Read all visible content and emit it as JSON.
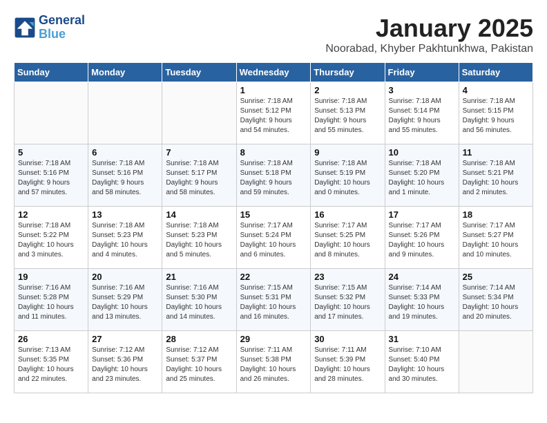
{
  "logo": {
    "line1": "General",
    "line2": "Blue"
  },
  "title": "January 2025",
  "subtitle": "Noorabad, Khyber Pakhtunkhwa, Pakistan",
  "days_of_week": [
    "Sunday",
    "Monday",
    "Tuesday",
    "Wednesday",
    "Thursday",
    "Friday",
    "Saturday"
  ],
  "weeks": [
    [
      {
        "day": "",
        "info": ""
      },
      {
        "day": "",
        "info": ""
      },
      {
        "day": "",
        "info": ""
      },
      {
        "day": "1",
        "info": "Sunrise: 7:18 AM\nSunset: 5:12 PM\nDaylight: 9 hours\nand 54 minutes."
      },
      {
        "day": "2",
        "info": "Sunrise: 7:18 AM\nSunset: 5:13 PM\nDaylight: 9 hours\nand 55 minutes."
      },
      {
        "day": "3",
        "info": "Sunrise: 7:18 AM\nSunset: 5:14 PM\nDaylight: 9 hours\nand 55 minutes."
      },
      {
        "day": "4",
        "info": "Sunrise: 7:18 AM\nSunset: 5:15 PM\nDaylight: 9 hours\nand 56 minutes."
      }
    ],
    [
      {
        "day": "5",
        "info": "Sunrise: 7:18 AM\nSunset: 5:16 PM\nDaylight: 9 hours\nand 57 minutes."
      },
      {
        "day": "6",
        "info": "Sunrise: 7:18 AM\nSunset: 5:16 PM\nDaylight: 9 hours\nand 58 minutes."
      },
      {
        "day": "7",
        "info": "Sunrise: 7:18 AM\nSunset: 5:17 PM\nDaylight: 9 hours\nand 58 minutes."
      },
      {
        "day": "8",
        "info": "Sunrise: 7:18 AM\nSunset: 5:18 PM\nDaylight: 9 hours\nand 59 minutes."
      },
      {
        "day": "9",
        "info": "Sunrise: 7:18 AM\nSunset: 5:19 PM\nDaylight: 10 hours\nand 0 minutes."
      },
      {
        "day": "10",
        "info": "Sunrise: 7:18 AM\nSunset: 5:20 PM\nDaylight: 10 hours\nand 1 minute."
      },
      {
        "day": "11",
        "info": "Sunrise: 7:18 AM\nSunset: 5:21 PM\nDaylight: 10 hours\nand 2 minutes."
      }
    ],
    [
      {
        "day": "12",
        "info": "Sunrise: 7:18 AM\nSunset: 5:22 PM\nDaylight: 10 hours\nand 3 minutes."
      },
      {
        "day": "13",
        "info": "Sunrise: 7:18 AM\nSunset: 5:23 PM\nDaylight: 10 hours\nand 4 minutes."
      },
      {
        "day": "14",
        "info": "Sunrise: 7:18 AM\nSunset: 5:23 PM\nDaylight: 10 hours\nand 5 minutes."
      },
      {
        "day": "15",
        "info": "Sunrise: 7:17 AM\nSunset: 5:24 PM\nDaylight: 10 hours\nand 6 minutes."
      },
      {
        "day": "16",
        "info": "Sunrise: 7:17 AM\nSunset: 5:25 PM\nDaylight: 10 hours\nand 8 minutes."
      },
      {
        "day": "17",
        "info": "Sunrise: 7:17 AM\nSunset: 5:26 PM\nDaylight: 10 hours\nand 9 minutes."
      },
      {
        "day": "18",
        "info": "Sunrise: 7:17 AM\nSunset: 5:27 PM\nDaylight: 10 hours\nand 10 minutes."
      }
    ],
    [
      {
        "day": "19",
        "info": "Sunrise: 7:16 AM\nSunset: 5:28 PM\nDaylight: 10 hours\nand 11 minutes."
      },
      {
        "day": "20",
        "info": "Sunrise: 7:16 AM\nSunset: 5:29 PM\nDaylight: 10 hours\nand 13 minutes."
      },
      {
        "day": "21",
        "info": "Sunrise: 7:16 AM\nSunset: 5:30 PM\nDaylight: 10 hours\nand 14 minutes."
      },
      {
        "day": "22",
        "info": "Sunrise: 7:15 AM\nSunset: 5:31 PM\nDaylight: 10 hours\nand 16 minutes."
      },
      {
        "day": "23",
        "info": "Sunrise: 7:15 AM\nSunset: 5:32 PM\nDaylight: 10 hours\nand 17 minutes."
      },
      {
        "day": "24",
        "info": "Sunrise: 7:14 AM\nSunset: 5:33 PM\nDaylight: 10 hours\nand 19 minutes."
      },
      {
        "day": "25",
        "info": "Sunrise: 7:14 AM\nSunset: 5:34 PM\nDaylight: 10 hours\nand 20 minutes."
      }
    ],
    [
      {
        "day": "26",
        "info": "Sunrise: 7:13 AM\nSunset: 5:35 PM\nDaylight: 10 hours\nand 22 minutes."
      },
      {
        "day": "27",
        "info": "Sunrise: 7:12 AM\nSunset: 5:36 PM\nDaylight: 10 hours\nand 23 minutes."
      },
      {
        "day": "28",
        "info": "Sunrise: 7:12 AM\nSunset: 5:37 PM\nDaylight: 10 hours\nand 25 minutes."
      },
      {
        "day": "29",
        "info": "Sunrise: 7:11 AM\nSunset: 5:38 PM\nDaylight: 10 hours\nand 26 minutes."
      },
      {
        "day": "30",
        "info": "Sunrise: 7:11 AM\nSunset: 5:39 PM\nDaylight: 10 hours\nand 28 minutes."
      },
      {
        "day": "31",
        "info": "Sunrise: 7:10 AM\nSunset: 5:40 PM\nDaylight: 10 hours\nand 30 minutes."
      },
      {
        "day": "",
        "info": ""
      }
    ]
  ]
}
